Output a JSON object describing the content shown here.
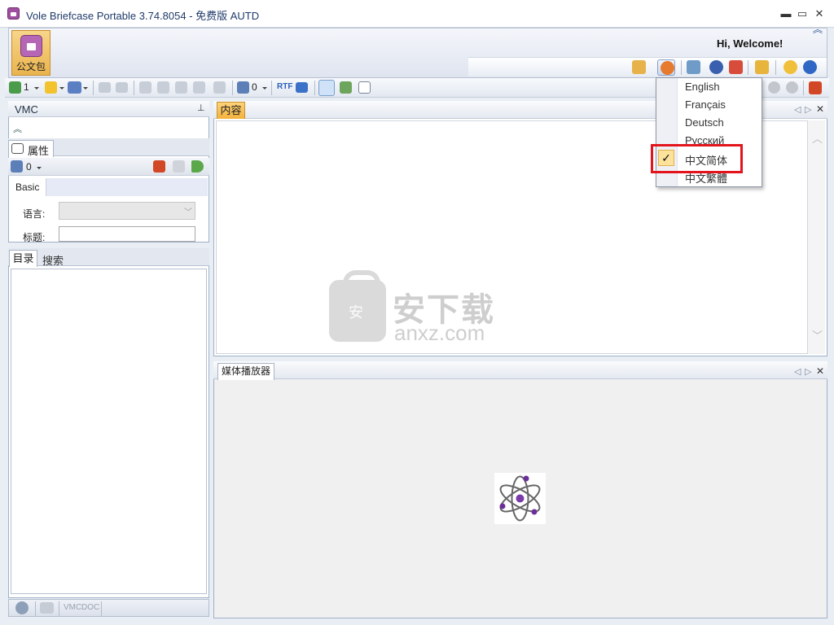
{
  "window": {
    "title": "Vole Briefcase Portable  3.74.8054 - 免费版 AUTD",
    "minimize": "▬",
    "maximize": "▭",
    "close": "✕"
  },
  "ribbon": {
    "app_button_label": "公文包",
    "welcome": "Hi, Welcome!",
    "collapse": "︽"
  },
  "toolbar": {
    "count_a": "1",
    "count_b": "0",
    "rtf": "RTF"
  },
  "left_panel": {
    "title": "VMC",
    "pin": "⊥",
    "expand": "︽",
    "properties_tab": "属性",
    "prop_count": "0",
    "basic_tab": "Basic",
    "language_label": "语言:",
    "title_label": "标题:",
    "tabs": [
      "目录",
      "搜索"
    ],
    "bottom_labels": [
      "VMC",
      "DOC"
    ]
  },
  "content_panel": {
    "tab": "内容"
  },
  "media_panel": {
    "tab": "媒体播放器"
  },
  "watermark": {
    "bag_text": "安",
    "cn": "安下载",
    "en": "anxz.com"
  },
  "language_menu": {
    "items": [
      "English",
      "Français",
      "Deutsch",
      "Русский",
      "中文简体",
      "中文繁體"
    ],
    "checked": "中文简体",
    "check_mark": "✓"
  },
  "colors": {
    "accent": "#f3b23c",
    "highlight": "#e3141c",
    "brand": "#a04fa0"
  }
}
